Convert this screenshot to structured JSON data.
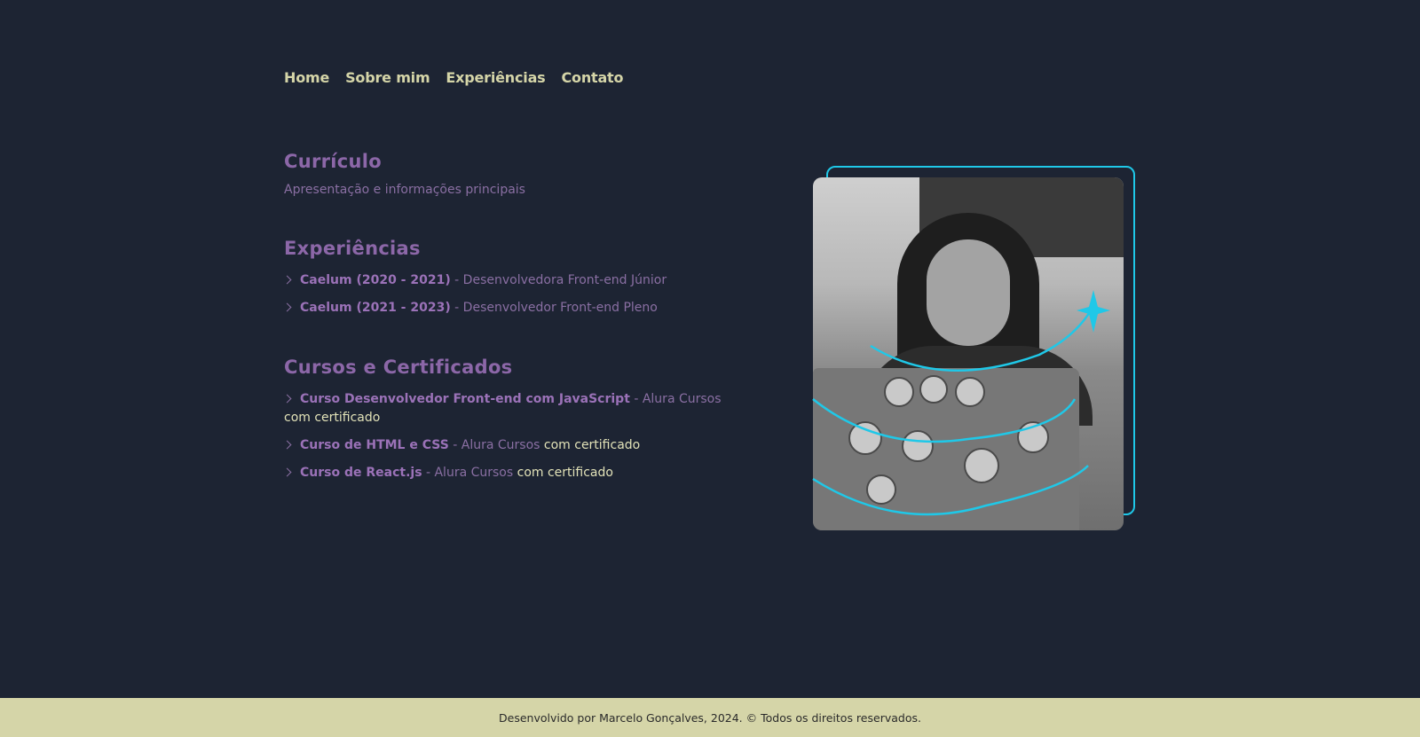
{
  "nav": {
    "items": [
      {
        "label": "Home"
      },
      {
        "label": "Sobre mim"
      },
      {
        "label": "Experiências"
      },
      {
        "label": "Contato"
      }
    ]
  },
  "header": {
    "title": "Currículo",
    "subtitle": "Apresentação e informações principais"
  },
  "experiences": {
    "title": "Experiências",
    "items": [
      {
        "company": "Caelum (2020 - 2021)",
        "role": " - Desenvolvedora Front-end Júnior"
      },
      {
        "company": "Caelum (2021 - 2023)",
        "role": " - Desenvolvedor Front-end Pleno"
      }
    ]
  },
  "courses": {
    "title": "Cursos e Certificados",
    "items": [
      {
        "name": "Curso Desenvolvedor Front-end com JavaScript",
        "provider": " - Alura Cursos ",
        "cert": "com certificado"
      },
      {
        "name": "Curso de HTML e CSS",
        "provider": " - Alura Cursos ",
        "cert": "com certificado"
      },
      {
        "name": "Curso de React.js",
        "provider": " - Alura Cursos ",
        "cert": "com certificado"
      }
    ]
  },
  "photo": {
    "icon": "sparkle-icon",
    "accent": "#1fc8e8"
  },
  "footer": {
    "text": "Desenvolvido por Marcelo Gonçalves, 2024. © Todos os direitos reservados."
  },
  "colors": {
    "background": "#1d2433",
    "nav": "#d5d5a8",
    "heading": "#8c67a8",
    "text": "#8a6fa3",
    "footer_bg": "#d5d5a8"
  }
}
